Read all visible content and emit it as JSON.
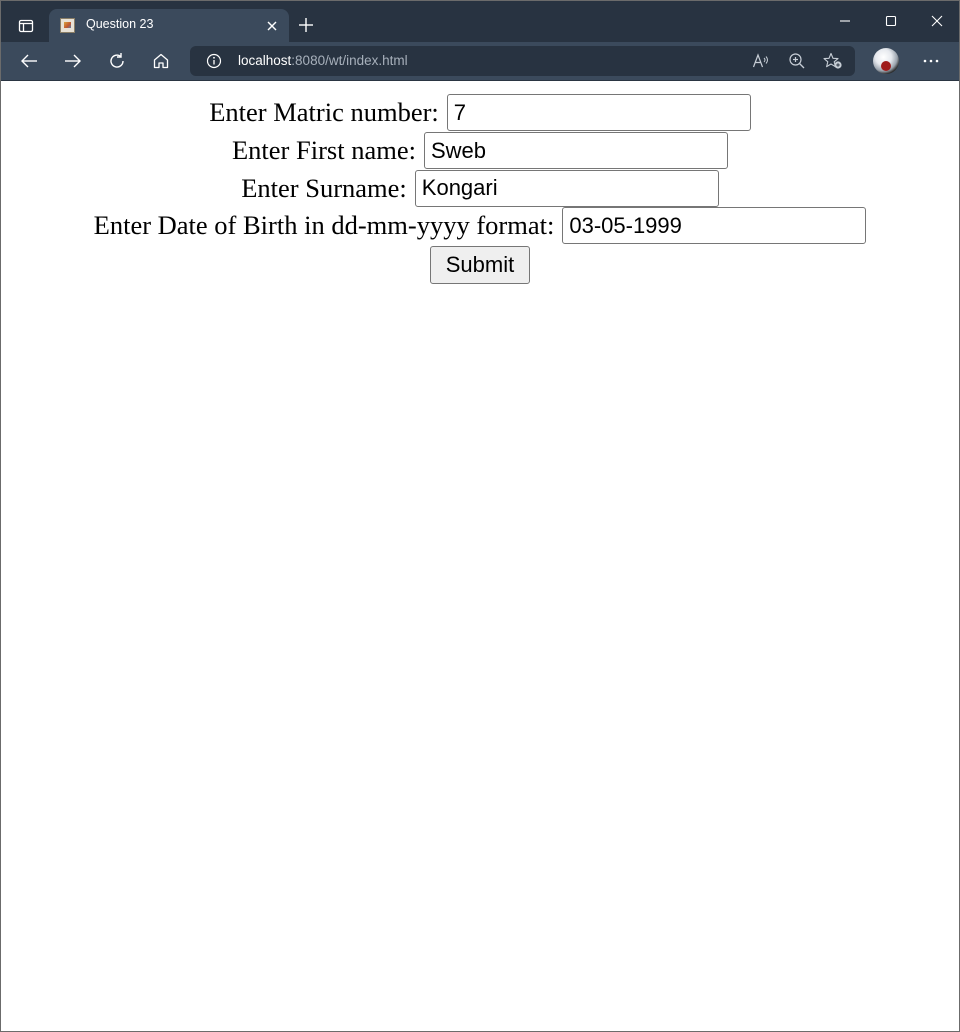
{
  "browser": {
    "tab_title": "Question 23",
    "url_host": "localhost",
    "url_rest": ":8080/wt/index.html",
    "icons": {
      "window_menu": "window-menu-icon",
      "tab_favicon": "favicon-icon",
      "tab_close": "close-icon",
      "new_tab": "plus-icon",
      "minimize": "minimize-icon",
      "maximize": "maximize-icon",
      "close_window": "close-icon",
      "back": "arrow-left-icon",
      "forward": "arrow-right-icon",
      "reload": "reload-icon",
      "home": "home-icon",
      "site_info": "info-icon",
      "read_aloud": "read-aloud-icon",
      "zoom": "zoom-in-icon",
      "favorites": "star-add-icon",
      "profile": "avatar",
      "more": "more-dots-icon"
    },
    "colors": {
      "titlebar": "#283341",
      "toolbar": "#3b4a5c",
      "address_bg": "#283341"
    }
  },
  "form": {
    "matric": {
      "label": "Enter Matric number:",
      "value": "7"
    },
    "first_name": {
      "label": "Enter First name:",
      "value": "Sweb"
    },
    "surname": {
      "label": "Enter Surname:",
      "value": "Kongari"
    },
    "dob": {
      "label": "Enter Date of Birth in dd-mm-yyyy format:",
      "value": "03-05-1999"
    },
    "submit_label": "Submit"
  }
}
